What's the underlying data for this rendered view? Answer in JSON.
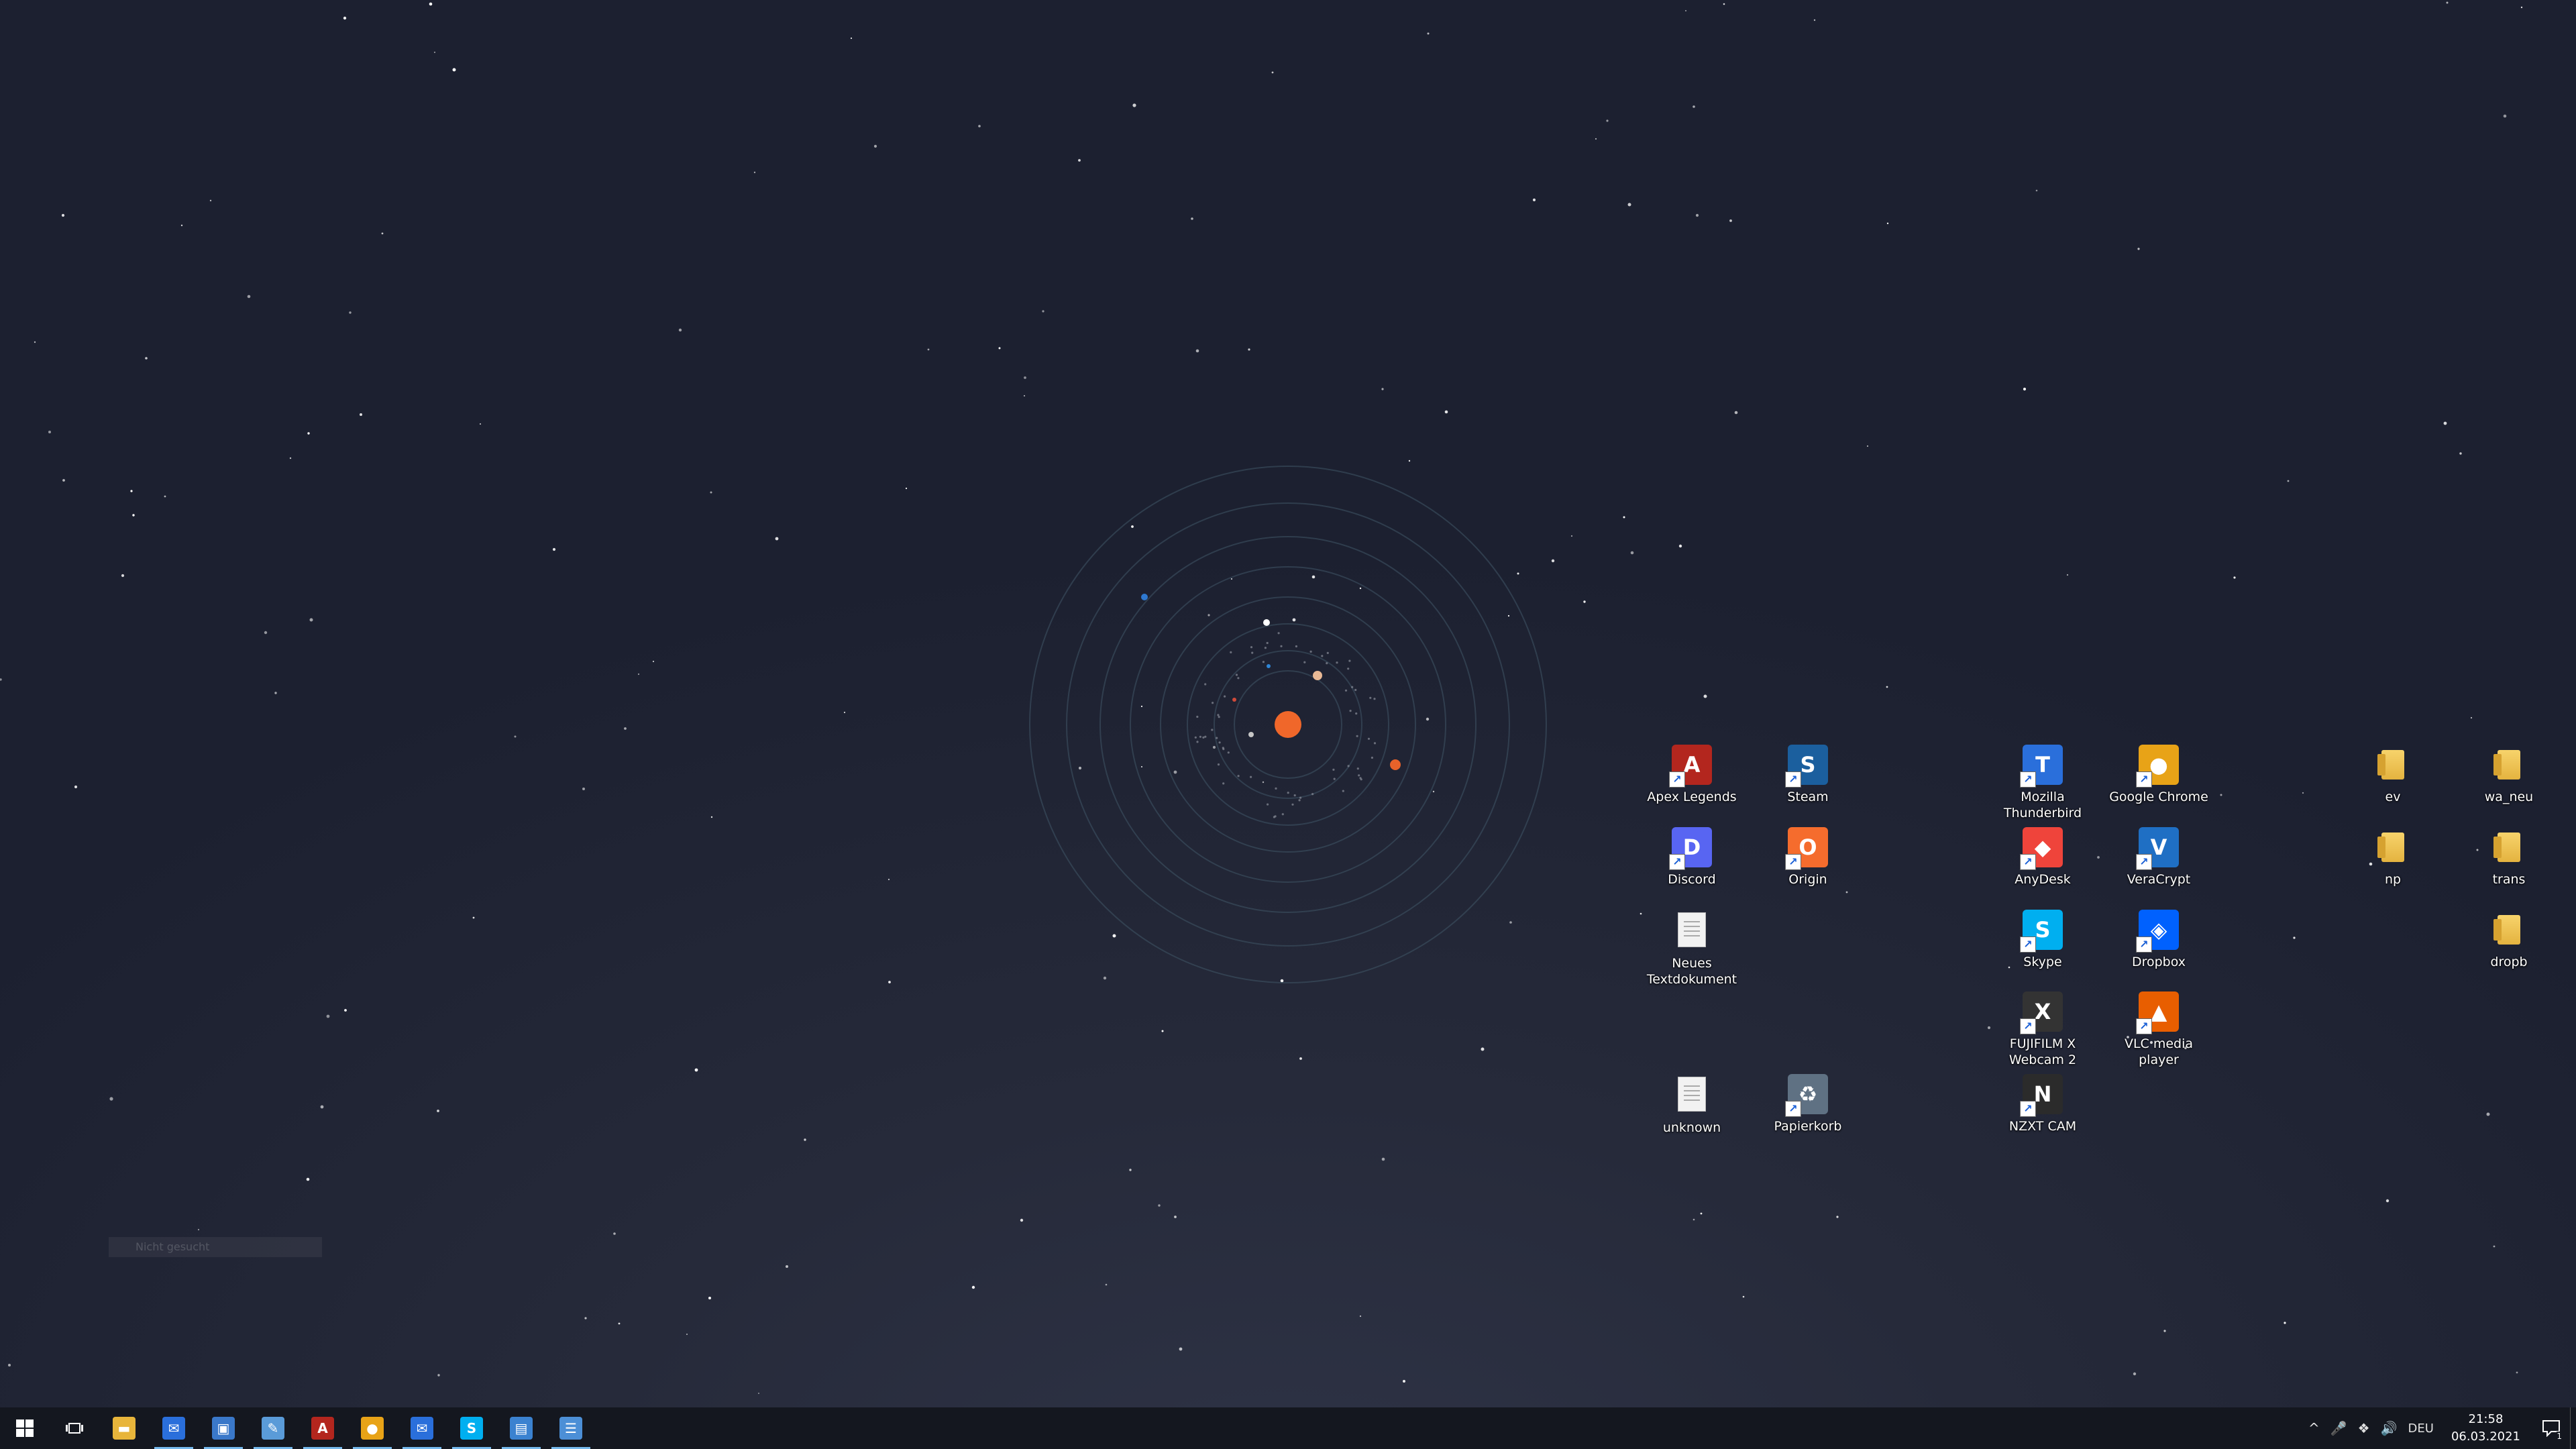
{
  "desktop": {
    "search_ghost_text": "Nicht gesucht",
    "icons": [
      {
        "label": "Apex Legends",
        "icon": "apex-legends-icon",
        "kind": "app",
        "color": "#b3261e",
        "glyph": "A"
      },
      {
        "label": "Steam",
        "icon": "steam-icon",
        "kind": "app",
        "color": "#1b5f9e",
        "glyph": "S"
      },
      {
        "label": "Mozilla Thunderbird",
        "icon": "thunderbird-icon",
        "kind": "app",
        "color": "#2a6fdb",
        "glyph": "T"
      },
      {
        "label": "Google Chrome",
        "icon": "chrome-icon",
        "kind": "app",
        "color": "#e8a317",
        "glyph": "●"
      },
      {
        "label": "ev",
        "icon": "folder-icon",
        "kind": "folder"
      },
      {
        "label": "wa_neu",
        "icon": "folder-icon",
        "kind": "folder"
      },
      {
        "label": "Discord",
        "icon": "discord-icon",
        "kind": "app",
        "color": "#5865f2",
        "glyph": "D"
      },
      {
        "label": "Origin",
        "icon": "origin-icon",
        "kind": "app",
        "color": "#f56c2d",
        "glyph": "O"
      },
      {
        "label": "AnyDesk",
        "icon": "anydesk-icon",
        "kind": "app",
        "color": "#ef443b",
        "glyph": "◆"
      },
      {
        "label": "VeraCrypt",
        "icon": "veracrypt-icon",
        "kind": "app",
        "color": "#1f6fc4",
        "glyph": "V"
      },
      {
        "label": "np",
        "icon": "folder-icon",
        "kind": "folder"
      },
      {
        "label": "trans",
        "icon": "folder-icon",
        "kind": "folder"
      },
      {
        "label": "Neues Textdokument",
        "icon": "text-document-icon",
        "kind": "doc"
      },
      {
        "label": "Skype",
        "icon": "skype-icon",
        "kind": "app",
        "color": "#00aff0",
        "glyph": "S"
      },
      {
        "label": "Dropbox",
        "icon": "dropbox-icon",
        "kind": "app",
        "color": "#0061fe",
        "glyph": "◈"
      },
      {
        "label": "dropb",
        "icon": "folder-icon",
        "kind": "folder"
      },
      {
        "label": "FUJIFILM X Webcam 2",
        "icon": "fujifilm-webcam-icon",
        "kind": "app",
        "color": "#333333",
        "glyph": "X"
      },
      {
        "label": "VLC media player",
        "icon": "vlc-icon",
        "kind": "app",
        "color": "#e85e00",
        "glyph": "▲"
      },
      {
        "label": "unknown",
        "icon": "image-file-icon",
        "kind": "doc"
      },
      {
        "label": "Papierkorb",
        "icon": "recycle-bin-icon",
        "kind": "app",
        "color": "#5f7183",
        "glyph": "♻"
      },
      {
        "label": "NZXT CAM",
        "icon": "nzxt-cam-icon",
        "kind": "app",
        "color": "#2b2b2b",
        "glyph": "N"
      }
    ]
  },
  "taskbar": {
    "start_icon": "windows-start-icon",
    "task_view_icon": "task-view-icon",
    "pinned": [
      {
        "name": "file-explorer",
        "icon": "folder-icon",
        "color": "#e8b53b",
        "glyph": "▬",
        "active": false
      },
      {
        "name": "mail-app",
        "icon": "mail-icon",
        "color": "#2a6fdb",
        "glyph": "✉",
        "active": true
      },
      {
        "name": "window-app",
        "icon": "window-icon",
        "color": "#3a78c9",
        "glyph": "▣",
        "active": true
      },
      {
        "name": "notepad-app",
        "icon": "notepad-icon",
        "color": "#5a9bd8",
        "glyph": "✎",
        "active": true
      },
      {
        "name": "apex-legends",
        "icon": "apex-legends-icon",
        "color": "#b3261e",
        "glyph": "A",
        "active": true
      },
      {
        "name": "google-chrome",
        "icon": "chrome-icon",
        "color": "#e8a317",
        "glyph": "●",
        "active": true
      },
      {
        "name": "thunderbird",
        "icon": "thunderbird-icon",
        "color": "#2a6fdb",
        "glyph": "✉",
        "active": true
      },
      {
        "name": "skype",
        "icon": "skype-icon",
        "color": "#00aff0",
        "glyph": "S",
        "active": true
      },
      {
        "name": "document-app",
        "icon": "document-icon",
        "color": "#3b82d0",
        "glyph": "▤",
        "active": true
      },
      {
        "name": "network-app",
        "icon": "network-icon",
        "color": "#4c8fd6",
        "glyph": "☰",
        "active": true
      }
    ],
    "tray": {
      "chevron_icon": "^",
      "mic_icon": "🎤",
      "dropbox_icon": "❖",
      "volume_icon": "🔊",
      "language": "DEU",
      "time": "21:58",
      "date": "06.03.2021",
      "notification_count": "1"
    }
  }
}
